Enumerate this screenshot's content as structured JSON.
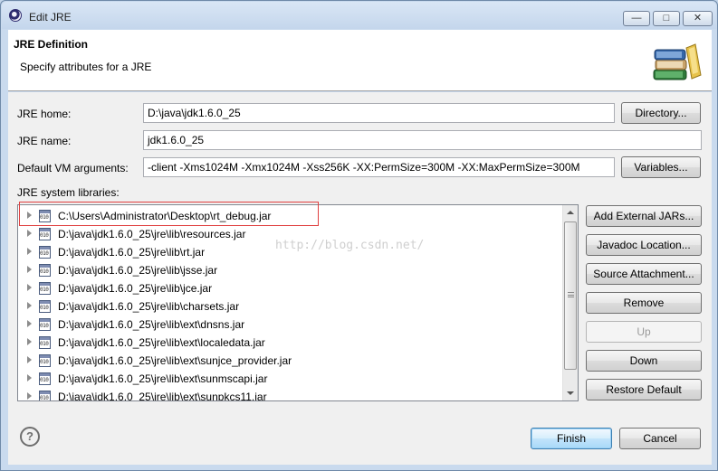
{
  "window": {
    "title": "Edit JRE"
  },
  "header": {
    "title": "JRE Definition",
    "subtitle": "Specify attributes for a JRE"
  },
  "form": {
    "jre_home_label": "JRE home:",
    "jre_home_value": "D:\\java\\jdk1.6.0_25",
    "directory_button": "Directory...",
    "jre_name_label": "JRE name:",
    "jre_name_value": "jdk1.6.0_25",
    "vm_args_label": "Default VM arguments:",
    "vm_args_value": "-client -Xms1024M -Xmx1024M -Xss256K -XX:PermSize=300M -XX:MaxPermSize=300M",
    "variables_button": "Variables...",
    "libraries_label": "JRE system libraries:"
  },
  "libraries": [
    "C:\\Users\\Administrator\\Desktop\\rt_debug.jar",
    "D:\\java\\jdk1.6.0_25\\jre\\lib\\resources.jar",
    "D:\\java\\jdk1.6.0_25\\jre\\lib\\rt.jar",
    "D:\\java\\jdk1.6.0_25\\jre\\lib\\jsse.jar",
    "D:\\java\\jdk1.6.0_25\\jre\\lib\\jce.jar",
    "D:\\java\\jdk1.6.0_25\\jre\\lib\\charsets.jar",
    "D:\\java\\jdk1.6.0_25\\jre\\lib\\ext\\dnsns.jar",
    "D:\\java\\jdk1.6.0_25\\jre\\lib\\ext\\localedata.jar",
    "D:\\java\\jdk1.6.0_25\\jre\\lib\\ext\\sunjce_provider.jar",
    "D:\\java\\jdk1.6.0_25\\jre\\lib\\ext\\sunmscapi.jar",
    "D:\\java\\jdk1.6.0_25\\jre\\lib\\ext\\sunpkcs11.jar"
  ],
  "jar_icon_text": "010",
  "side_buttons": {
    "add_external_jars": "Add External JARs...",
    "javadoc_location": "Javadoc Location...",
    "source_attachment": "Source Attachment...",
    "remove": "Remove",
    "up": "Up",
    "down": "Down",
    "restore_default": "Restore Default"
  },
  "watermark": "http://blog.csdn.net/",
  "footer": {
    "help_glyph": "?",
    "finish": "Finish",
    "cancel": "Cancel"
  },
  "titlebar_buttons": {
    "minimize": "—",
    "maximize": "□",
    "close": "✕"
  }
}
